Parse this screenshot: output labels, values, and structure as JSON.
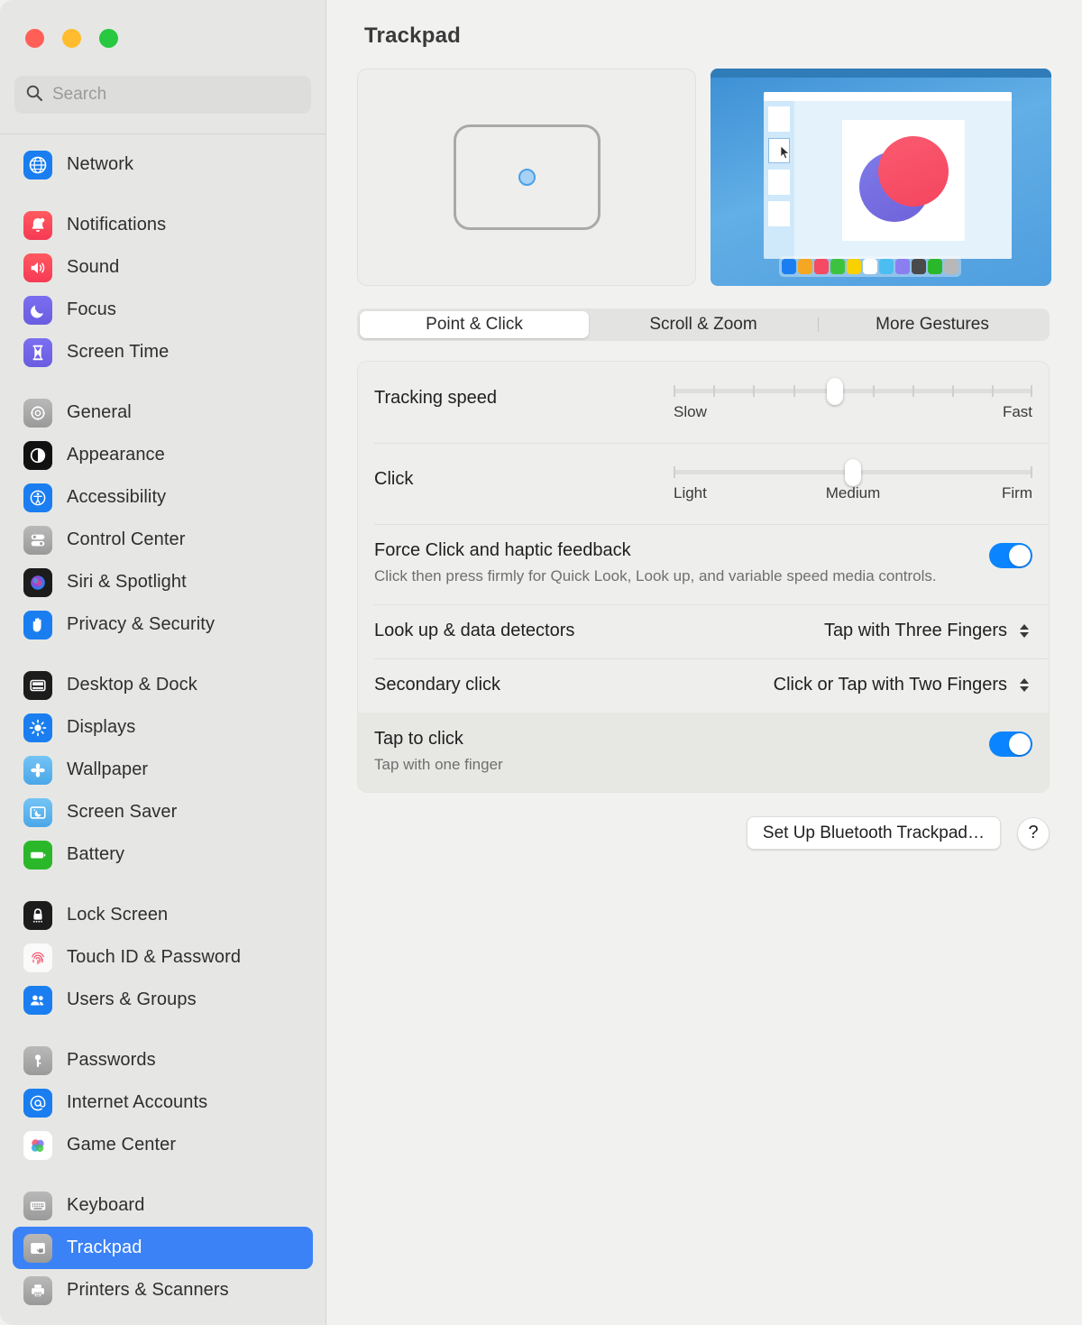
{
  "window": {
    "traffic_lights": [
      "close",
      "minimize",
      "zoom"
    ],
    "colors": {
      "accent": "#3b82f7",
      "toggle_on": "#0a84ff",
      "sidebar_bg": "#e6e7e4",
      "main_bg": "#f1f1f0"
    }
  },
  "search": {
    "placeholder": "Search",
    "value": "",
    "icon": "search-icon"
  },
  "sidebar": {
    "groups": [
      {
        "items": [
          {
            "label": "Network",
            "icon": "globe-icon",
            "selected": false
          }
        ]
      },
      {
        "items": [
          {
            "label": "Notifications",
            "icon": "bell-icon",
            "selected": false
          },
          {
            "label": "Sound",
            "icon": "speaker-icon",
            "selected": false
          },
          {
            "label": "Focus",
            "icon": "moon-icon",
            "selected": false
          },
          {
            "label": "Screen Time",
            "icon": "hourglass-icon",
            "selected": false
          }
        ]
      },
      {
        "items": [
          {
            "label": "General",
            "icon": "gear-icon",
            "selected": false
          },
          {
            "label": "Appearance",
            "icon": "appearance-icon",
            "selected": false
          },
          {
            "label": "Accessibility",
            "icon": "accessibility-icon",
            "selected": false
          },
          {
            "label": "Control Center",
            "icon": "control-center-icon",
            "selected": false
          },
          {
            "label": "Siri & Spotlight",
            "icon": "siri-icon",
            "selected": false
          },
          {
            "label": "Privacy & Security",
            "icon": "hand-icon",
            "selected": false
          }
        ]
      },
      {
        "items": [
          {
            "label": "Desktop & Dock",
            "icon": "desktop-dock-icon",
            "selected": false
          },
          {
            "label": "Displays",
            "icon": "brightness-icon",
            "selected": false
          },
          {
            "label": "Wallpaper",
            "icon": "wallpaper-icon",
            "selected": false
          },
          {
            "label": "Screen Saver",
            "icon": "screen-saver-icon",
            "selected": false
          },
          {
            "label": "Battery",
            "icon": "battery-icon",
            "selected": false
          }
        ]
      },
      {
        "items": [
          {
            "label": "Lock Screen",
            "icon": "lock-icon",
            "selected": false
          },
          {
            "label": "Touch ID & Password",
            "icon": "fingerprint-icon",
            "selected": false
          },
          {
            "label": "Users & Groups",
            "icon": "users-icon",
            "selected": false
          }
        ]
      },
      {
        "items": [
          {
            "label": "Passwords",
            "icon": "key-icon",
            "selected": false
          },
          {
            "label": "Internet Accounts",
            "icon": "at-icon",
            "selected": false
          },
          {
            "label": "Game Center",
            "icon": "game-center-icon",
            "selected": false
          }
        ]
      },
      {
        "items": [
          {
            "label": "Keyboard",
            "icon": "keyboard-icon",
            "selected": false
          },
          {
            "label": "Trackpad",
            "icon": "trackpad-icon",
            "selected": true
          },
          {
            "label": "Printers & Scanners",
            "icon": "printer-icon",
            "selected": false
          }
        ]
      }
    ]
  },
  "main": {
    "title": "Trackpad",
    "preview": {
      "trackpad_graphic": "trackpad-outline-with-touch-point",
      "demo_image": {
        "swatches": [
          "#1a7ef0",
          "#f5a623",
          "#f54a62",
          "#3dc23f",
          "#f9d000",
          "#ffffff",
          "#4cbdf0",
          "#8b7ef0",
          "#4a4a4a",
          "#2ab82a",
          "#b8b8b8"
        ],
        "thumbnails": 4,
        "active_thumbnail": 2,
        "cursor": "arrow-cursor"
      }
    },
    "tabs": [
      {
        "label": "Point & Click",
        "active": true
      },
      {
        "label": "Scroll & Zoom",
        "active": false
      },
      {
        "label": "More Gestures",
        "active": false
      }
    ],
    "settings": {
      "tracking_speed": {
        "label": "Tracking speed",
        "min_label": "Slow",
        "max_label": "Fast",
        "ticks": 10,
        "value_index": 4
      },
      "click": {
        "label": "Click",
        "min_label": "Light",
        "mid_label": "Medium",
        "max_label": "Firm",
        "value_percent": 50
      },
      "force_click": {
        "label": "Force Click and haptic feedback",
        "description": "Click then press firmly for Quick Look, Look up, and variable speed media controls.",
        "enabled": true
      },
      "look_up": {
        "label": "Look up & data detectors",
        "value": "Tap with Three Fingers"
      },
      "secondary_click": {
        "label": "Secondary click",
        "value": "Click or Tap with Two Fingers"
      },
      "tap_to_click": {
        "label": "Tap to click",
        "description": "Tap with one finger",
        "enabled": true
      }
    },
    "footer": {
      "setup_button": "Set Up Bluetooth Trackpad…",
      "help_button": "?"
    }
  }
}
